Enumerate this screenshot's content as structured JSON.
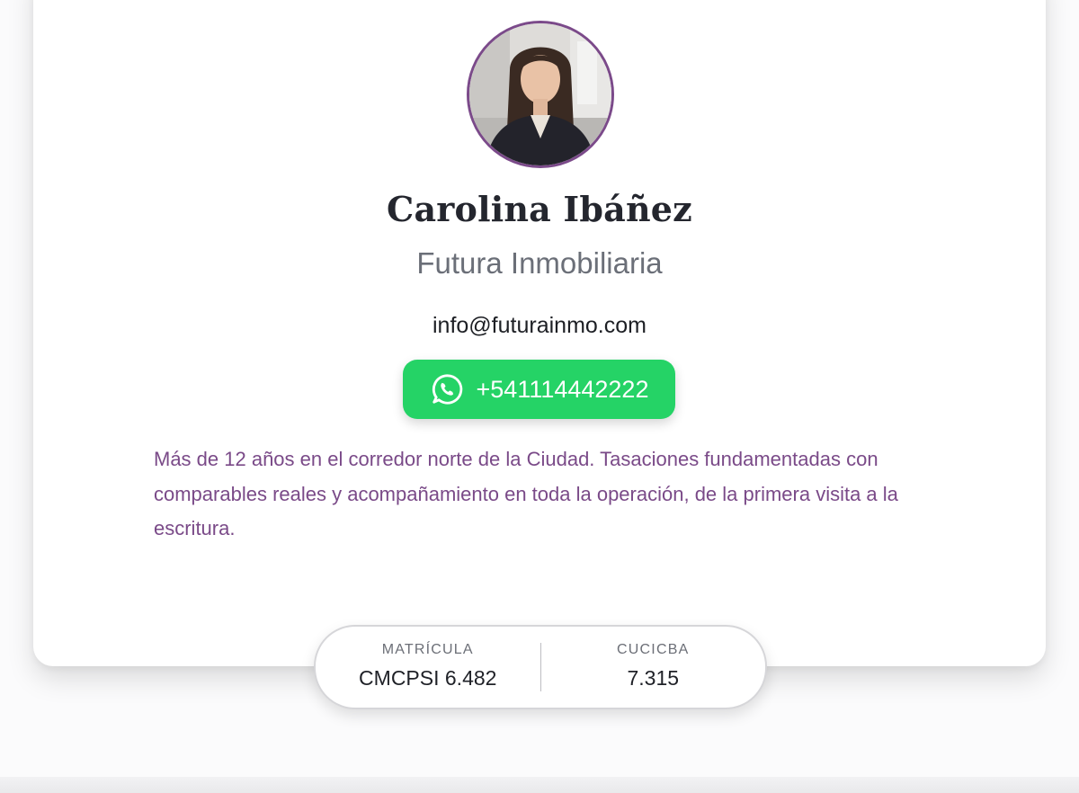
{
  "profile": {
    "avatar_icon": "person-photo",
    "name": "Carolina Ibáñez",
    "company": "Futura Inmobiliaria",
    "email": "info@futurainmo.com",
    "whatsapp": {
      "icon": "whatsapp-icon",
      "number": "+541114442222",
      "color": "#25d366"
    },
    "bio": "Más de 12 años en el corredor norte de la Ciudad. Tasaciones fundamentadas con comparables reales y acompañamiento en toda la operación, de la primera visita a la escritura."
  },
  "credentials": [
    {
      "label": "MATRÍCULA",
      "value": "CMCPSI 6.482"
    },
    {
      "label": "CUCICBA",
      "value": "7.315"
    }
  ],
  "colors": {
    "accent": "#7b4a8a",
    "bio_text": "#7a4a88",
    "name_text": "#24262e"
  }
}
